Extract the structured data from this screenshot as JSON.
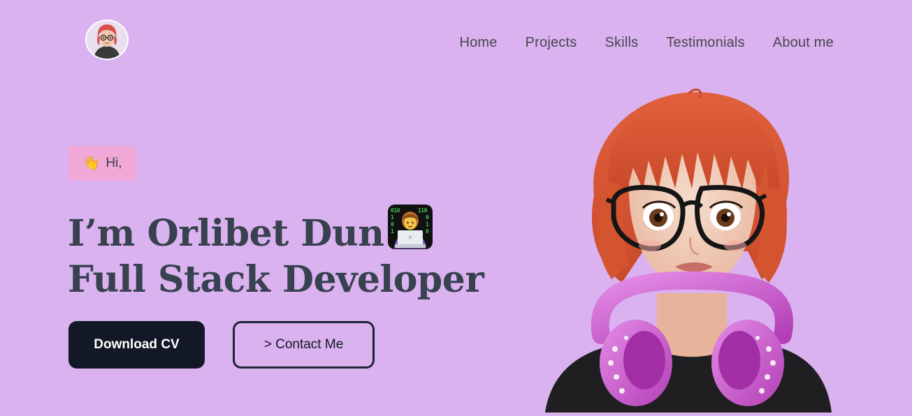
{
  "header": {
    "logo_alt": "avatar",
    "nav": [
      {
        "label": "Home"
      },
      {
        "label": "Projects"
      },
      {
        "label": "Skills"
      },
      {
        "label": "Testimonials"
      },
      {
        "label": "About me"
      }
    ]
  },
  "hero": {
    "greeting": {
      "icon": "waving-hand-icon",
      "text": "Hi,"
    },
    "title_line1": "I’m Orlibet Dun",
    "title_icon": "woman-technologist-icon",
    "title_line2": "Full Stack Developer",
    "download_label": "Download CV",
    "contact_label": "> Contact Me"
  },
  "colors": {
    "background": "#d9b2ef",
    "badge": "#f0a9d6",
    "primary_button": "#121826",
    "heading": "#38414f"
  }
}
